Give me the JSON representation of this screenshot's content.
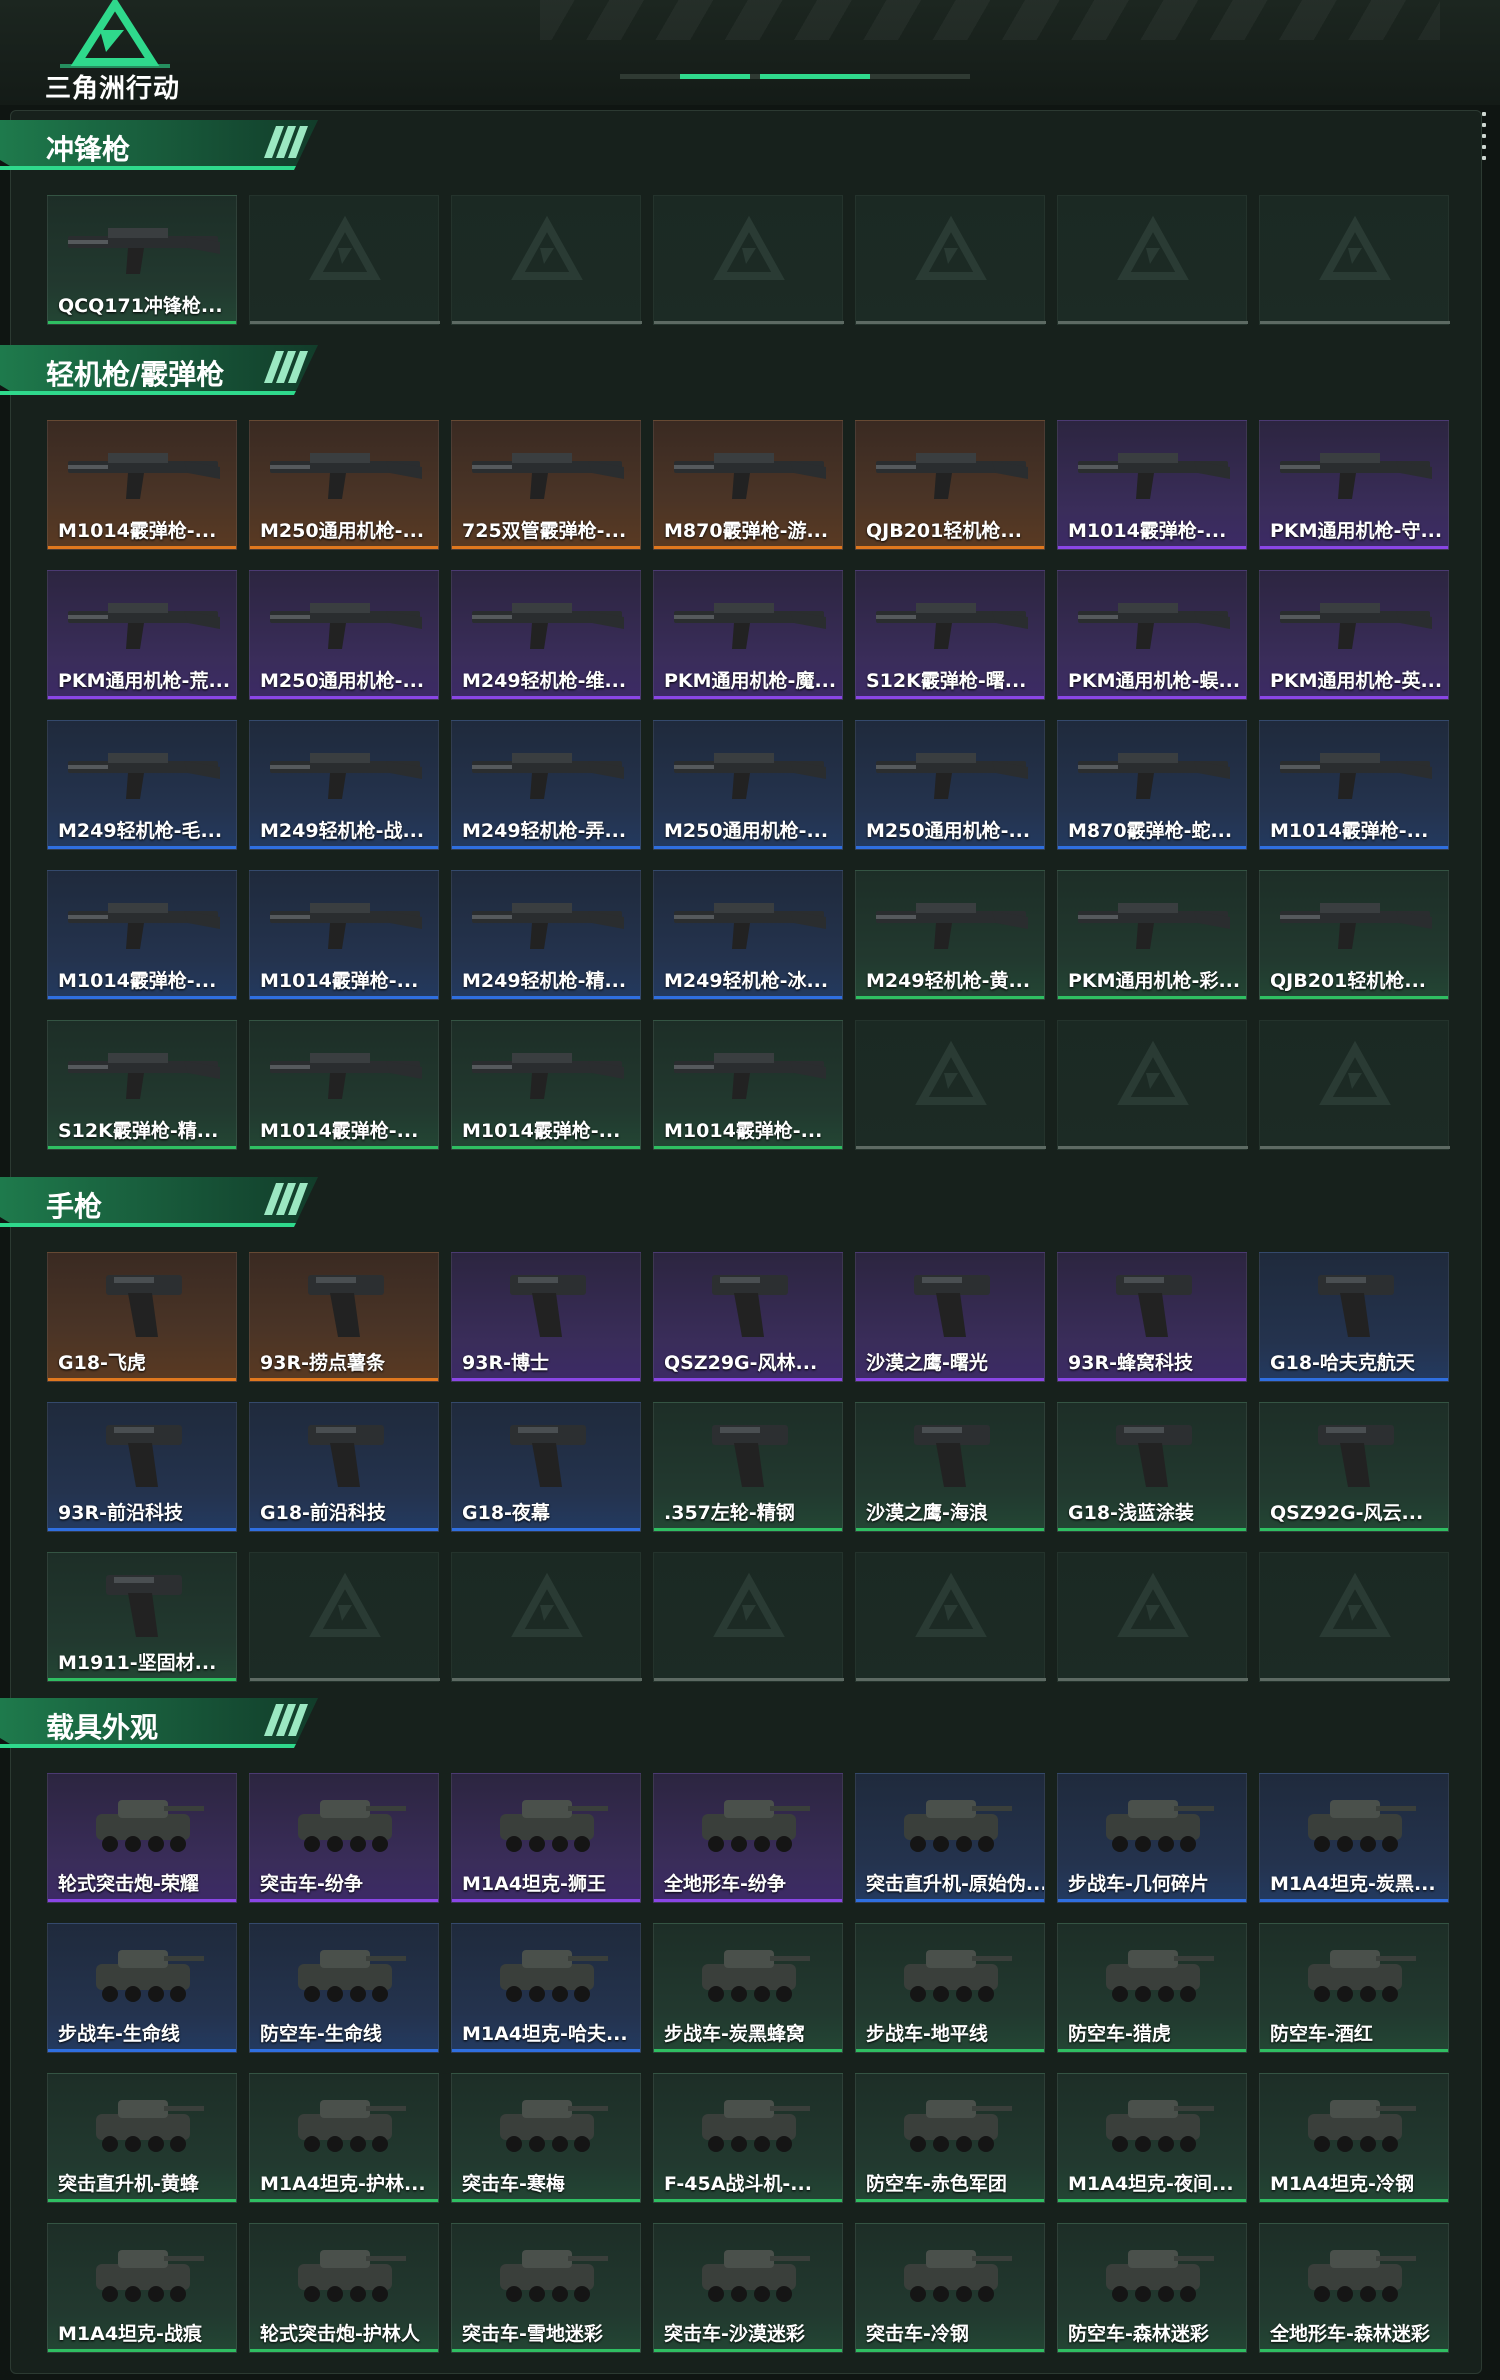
{
  "app": {
    "logo_text": "三角洲行动",
    "colors": {
      "accent": "#2fd98c",
      "legendary": "#e0781e",
      "epic": "#8a46e6",
      "rare": "#2f6fe0",
      "uncommon": "#2fbf62"
    }
  },
  "sections": [
    {
      "title": "冲锋枪",
      "items": [
        {
          "label": "QCQ171冲锋枪...",
          "rarity": "uncommon"
        }
      ],
      "empty_slots": 6
    },
    {
      "title": "轻机枪/霰弹枪",
      "items": [
        {
          "label": "M1014霰弹枪-...",
          "rarity": "legendary"
        },
        {
          "label": "M250通用机枪-...",
          "rarity": "legendary"
        },
        {
          "label": "725双管霰弹枪-...",
          "rarity": "legendary"
        },
        {
          "label": "M870霰弹枪-游...",
          "rarity": "legendary"
        },
        {
          "label": "QJB201轻机枪...",
          "rarity": "legendary"
        },
        {
          "label": "M1014霰弹枪-...",
          "rarity": "epic"
        },
        {
          "label": "PKM通用机枪-守...",
          "rarity": "epic"
        },
        {
          "label": "PKM通用机枪-荒...",
          "rarity": "epic"
        },
        {
          "label": "M250通用机枪-...",
          "rarity": "epic"
        },
        {
          "label": "M249轻机枪-维...",
          "rarity": "epic"
        },
        {
          "label": "PKM通用机枪-魔...",
          "rarity": "epic"
        },
        {
          "label": "S12K霰弹枪-曙...",
          "rarity": "epic"
        },
        {
          "label": "PKM通用机枪-蜈...",
          "rarity": "epic"
        },
        {
          "label": "PKM通用机枪-英...",
          "rarity": "epic"
        },
        {
          "label": "M249轻机枪-毛...",
          "rarity": "rare"
        },
        {
          "label": "M249轻机枪-战...",
          "rarity": "rare"
        },
        {
          "label": "M249轻机枪-弄...",
          "rarity": "rare"
        },
        {
          "label": "M250通用机枪-...",
          "rarity": "rare"
        },
        {
          "label": "M250通用机枪-...",
          "rarity": "rare"
        },
        {
          "label": "M870霰弹枪-蛇...",
          "rarity": "rare"
        },
        {
          "label": "M1014霰弹枪-...",
          "rarity": "rare"
        },
        {
          "label": "M1014霰弹枪-...",
          "rarity": "rare"
        },
        {
          "label": "M1014霰弹枪-...",
          "rarity": "rare"
        },
        {
          "label": "M249轻机枪-精...",
          "rarity": "rare"
        },
        {
          "label": "M249轻机枪-冰...",
          "rarity": "rare"
        },
        {
          "label": "M249轻机枪-黄...",
          "rarity": "uncommon"
        },
        {
          "label": "PKM通用机枪-彩...",
          "rarity": "uncommon"
        },
        {
          "label": "QJB201轻机枪...",
          "rarity": "uncommon"
        },
        {
          "label": "S12K霰弹枪-精...",
          "rarity": "uncommon"
        },
        {
          "label": "M1014霰弹枪-...",
          "rarity": "uncommon"
        },
        {
          "label": "M1014霰弹枪-...",
          "rarity": "uncommon"
        },
        {
          "label": "M1014霰弹枪-...",
          "rarity": "uncommon"
        }
      ],
      "empty_slots": 3
    },
    {
      "title": "手枪",
      "items": [
        {
          "label": "G18-飞虎",
          "rarity": "legendary"
        },
        {
          "label": "93R-捞点薯条",
          "rarity": "legendary"
        },
        {
          "label": "93R-博士",
          "rarity": "epic"
        },
        {
          "label": "QSZ29G-风林...",
          "rarity": "epic"
        },
        {
          "label": "沙漠之鹰-曙光",
          "rarity": "epic"
        },
        {
          "label": "93R-蜂窝科技",
          "rarity": "epic"
        },
        {
          "label": "G18-哈夫克航天",
          "rarity": "rare"
        },
        {
          "label": "93R-前沿科技",
          "rarity": "rare"
        },
        {
          "label": "G18-前沿科技",
          "rarity": "rare"
        },
        {
          "label": "G18-夜幕",
          "rarity": "rare"
        },
        {
          "label": ".357左轮-精钢",
          "rarity": "uncommon"
        },
        {
          "label": "沙漠之鹰-海浪",
          "rarity": "uncommon"
        },
        {
          "label": "G18-浅蓝涂装",
          "rarity": "uncommon"
        },
        {
          "label": "QSZ92G-风云...",
          "rarity": "uncommon"
        },
        {
          "label": "M1911-坚固材...",
          "rarity": "uncommon"
        }
      ],
      "empty_slots": 6
    },
    {
      "title": "载具外观",
      "items": [
        {
          "label": "轮式突击炮-荣耀",
          "rarity": "epic"
        },
        {
          "label": "突击车-纷争",
          "rarity": "epic"
        },
        {
          "label": "M1A4坦克-狮王",
          "rarity": "epic"
        },
        {
          "label": "全地形车-纷争",
          "rarity": "epic"
        },
        {
          "label": "突击直升机-原始伪...",
          "rarity": "rare"
        },
        {
          "label": "步战车-几何碎片",
          "rarity": "rare"
        },
        {
          "label": "M1A4坦克-炭黑...",
          "rarity": "rare"
        },
        {
          "label": "步战车-生命线",
          "rarity": "rare"
        },
        {
          "label": "防空车-生命线",
          "rarity": "rare"
        },
        {
          "label": "M1A4坦克-哈夫...",
          "rarity": "rare"
        },
        {
          "label": "步战车-炭黑蜂窝",
          "rarity": "uncommon"
        },
        {
          "label": "步战车-地平线",
          "rarity": "uncommon"
        },
        {
          "label": "防空车-猎虎",
          "rarity": "uncommon"
        },
        {
          "label": "防空车-酒红",
          "rarity": "uncommon"
        },
        {
          "label": "突击直升机-黄蜂",
          "rarity": "uncommon"
        },
        {
          "label": "M1A4坦克-护林...",
          "rarity": "uncommon"
        },
        {
          "label": "突击车-寒梅",
          "rarity": "uncommon"
        },
        {
          "label": "F-45A战斗机-...",
          "rarity": "uncommon"
        },
        {
          "label": "防空车-赤色军团",
          "rarity": "uncommon"
        },
        {
          "label": "M1A4坦克-夜间...",
          "rarity": "uncommon"
        },
        {
          "label": "M1A4坦克-冷钢",
          "rarity": "uncommon"
        },
        {
          "label": "M1A4坦克-战痕",
          "rarity": "uncommon"
        },
        {
          "label": "轮式突击炮-护林人",
          "rarity": "uncommon"
        },
        {
          "label": "突击车-雪地迷彩",
          "rarity": "uncommon"
        },
        {
          "label": "突击车-沙漠迷彩",
          "rarity": "uncommon"
        },
        {
          "label": "突击车-冷钢",
          "rarity": "uncommon"
        },
        {
          "label": "防空车-森林迷彩",
          "rarity": "uncommon"
        },
        {
          "label": "全地形车-森林迷彩",
          "rarity": "uncommon"
        }
      ],
      "empty_slots": 0
    }
  ]
}
